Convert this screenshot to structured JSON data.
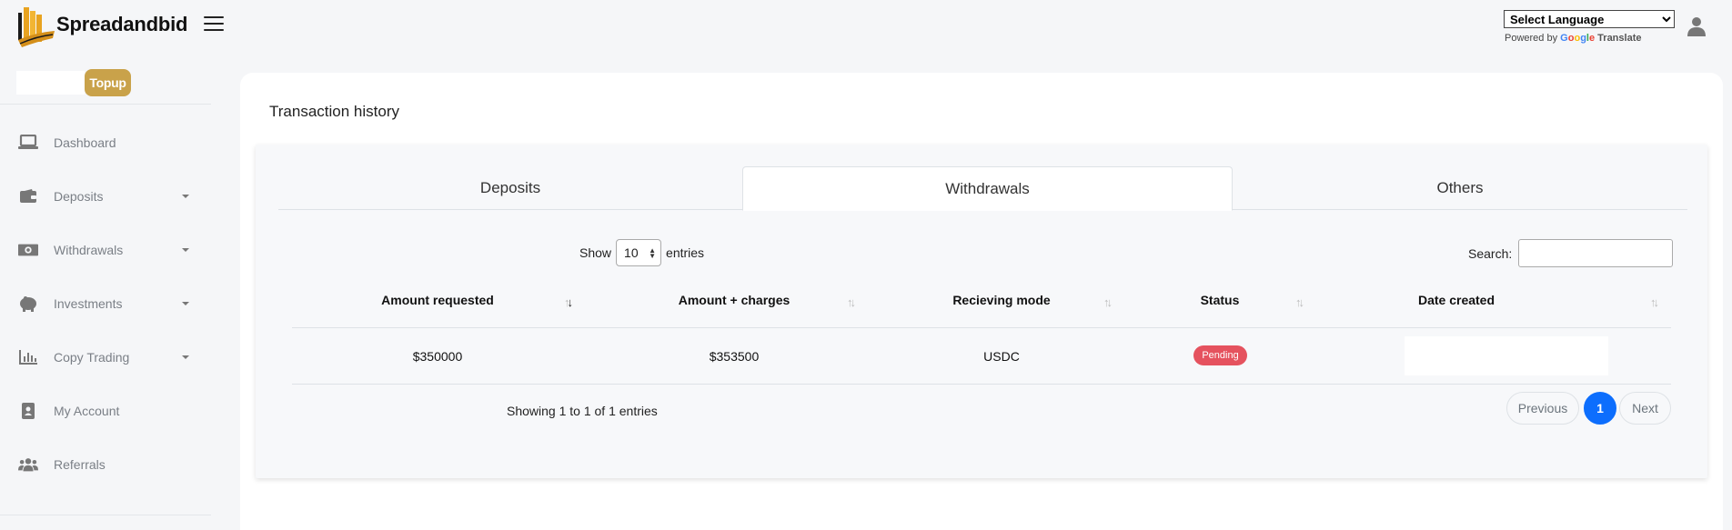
{
  "header": {
    "brand": "Spreadandbid",
    "language_select": "Select Language",
    "powered_by": "Powered by",
    "google": [
      "G",
      "o",
      "o",
      "g",
      "l",
      "e"
    ],
    "translate": "Translate"
  },
  "sidebar": {
    "topup_label": "Topup",
    "items": [
      {
        "label": "Dashboard",
        "icon": "laptop-icon"
      },
      {
        "label": "Deposits",
        "icon": "wallet-icon"
      },
      {
        "label": "Withdrawals",
        "icon": "money-icon"
      },
      {
        "label": "Investments",
        "icon": "piggy-bank-icon"
      },
      {
        "label": "Copy Trading",
        "icon": "bar-chart-icon"
      },
      {
        "label": "My Account",
        "icon": "id-badge-icon"
      },
      {
        "label": "Referrals",
        "icon": "users-icon"
      }
    ]
  },
  "main": {
    "title": "Transaction history",
    "tabs": [
      {
        "label": "Deposits"
      },
      {
        "label": "Withdrawals"
      },
      {
        "label": "Others"
      }
    ],
    "show_label": "Show",
    "page_length": "10",
    "entries_label": "entries",
    "search_label": "Search:",
    "table": {
      "columns": [
        "Amount requested",
        "Amount + charges",
        "Recieving mode",
        "Status",
        "Date created"
      ],
      "rows": [
        {
          "amount_requested": "$350000",
          "amount_charges": "$353500",
          "receiving_mode": "USDC",
          "status": "Pending"
        }
      ]
    },
    "info": "Showing 1 to 1 of 1 entries",
    "pagination": {
      "previous": "Previous",
      "current": "1",
      "next": "Next"
    }
  },
  "colors": {
    "accent_gold": "#c9a24a",
    "pending_red": "#e5525e",
    "page_active_blue": "#0d6efd"
  }
}
